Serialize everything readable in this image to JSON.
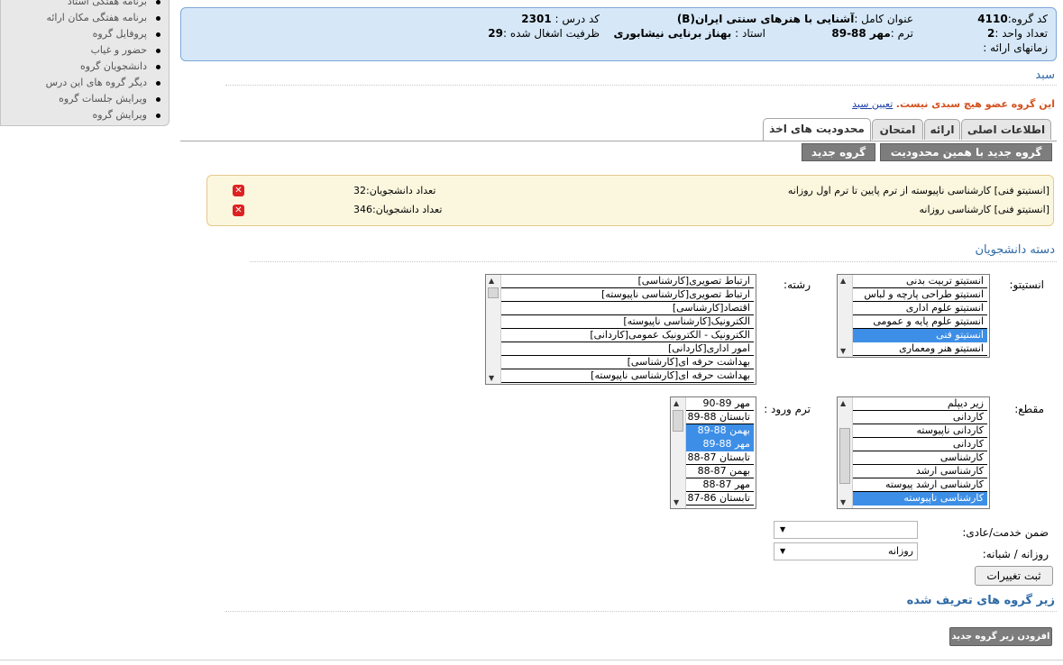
{
  "sidebar": {
    "items": [
      {
        "label": "برنامه هفتگی استاد"
      },
      {
        "label": "برنامه هفتگی مکان ارائه"
      },
      {
        "label": "پروفایل گروه"
      },
      {
        "label": "حضور و غیاب"
      },
      {
        "label": "دانشجویان گروه"
      },
      {
        "label": "دیگر گروه های این درس"
      },
      {
        "label": "ویرایش جلسات گروه"
      },
      {
        "label": "ویرایش گروه"
      }
    ]
  },
  "info": {
    "group_code_label": "کد گروه:",
    "group_code": "4110",
    "full_title_label": "عنوان کامل :",
    "full_title": "آشنایی با هنرهای سنتی ایران(B)",
    "course_code_label": "کد درس :",
    "course_code": "2301",
    "units_label": "تعداد واحد :",
    "units": "2",
    "term_label": "ترم :",
    "term": "مهر 88-89",
    "teacher_label": "استاد :",
    "teacher": "بهناز برنایی نیشابوری",
    "capacity_label": "ظرفیت اشغال شده :",
    "capacity": "29",
    "times_label": "زمانهای ارائه :"
  },
  "sabad": {
    "title": "سبد",
    "notice": "این گروه عضو هیچ سبدی نیست.",
    "link": "تعیین سبد"
  },
  "tabs": [
    {
      "label": "اطلاعات اصلی"
    },
    {
      "label": "ارائه"
    },
    {
      "label": "امتحان"
    },
    {
      "label": "محدودیت های اخذ"
    }
  ],
  "actions": {
    "new_same_label": "گروه جدید با همین محدودیت",
    "new_group_label": "گروه جدید"
  },
  "restrictions": [
    {
      "desc": "[انستیتو فنی] کارشناسی ناپیوسته از ترم پایین تا ترم اول روزانه",
      "count": "تعداد دانشجویان:32"
    },
    {
      "desc": "[انستیتو فنی] کارشناسی روزانه",
      "count": "تعداد دانشجویان:346"
    }
  ],
  "students_section": {
    "title": "دسته دانشجویان",
    "institute_label": "انستیتو:",
    "field_label": "رشته:",
    "level_label": "مقطع:",
    "entry_term_label": "ترم ورود :",
    "service_label": "ضمن خدمت/عادی:",
    "shift_label": "روزانه / شبانه:",
    "shift_value": "روزانه",
    "service_value": "",
    "save_label": "ثبت تغییرات"
  },
  "institutes": [
    {
      "label": "انستیتو تربیت بدنی",
      "selected": false
    },
    {
      "label": "انستیتو طراحی پارچه و لباس",
      "selected": false
    },
    {
      "label": "انستیتو علوم اداری",
      "selected": false
    },
    {
      "label": "انستیتو علوم پایه و عمومی",
      "selected": false
    },
    {
      "label": "انستیتو فنی",
      "selected": true
    },
    {
      "label": "انستیتو هنر ومعماری",
      "selected": false
    }
  ],
  "fields": [
    {
      "label": "ارتباط تصویری[کارشناسی]",
      "selected": false
    },
    {
      "label": "ارتباط تصویری[کارشناسی ناپیوسته]",
      "selected": false
    },
    {
      "label": "اقتصاد[کارشناسی]",
      "selected": false
    },
    {
      "label": "الکترونیک[کارشناسی ناپیوسته]",
      "selected": false
    },
    {
      "label": "الکترونیک - الکترونیک عمومی[کاردانی]",
      "selected": false
    },
    {
      "label": "امور اداری[کاردانی]",
      "selected": false
    },
    {
      "label": "بهداشت حرفه ای[کارشناسی]",
      "selected": false
    },
    {
      "label": "بهداشت حرفه ای[کارشناسی ناپیوسته]",
      "selected": false
    }
  ],
  "levels": [
    {
      "label": "زیر دیپلم",
      "selected": false
    },
    {
      "label": "کاردانی",
      "selected": false
    },
    {
      "label": "کاردانی ناپیوسته",
      "selected": false
    },
    {
      "label": "کاردانی",
      "selected": false
    },
    {
      "label": "کارشناسی",
      "selected": false
    },
    {
      "label": "کارشناسی ارشد",
      "selected": false
    },
    {
      "label": "کارشناسی ارشد پیوسته",
      "selected": false
    },
    {
      "label": "کارشناسی ناپیوسته",
      "selected": true
    }
  ],
  "entry_terms": [
    {
      "label": "مهر 89-90",
      "selected": false
    },
    {
      "label": "تابستان 88-89",
      "selected": false
    },
    {
      "label": "بهمن 88-89",
      "selected": true
    },
    {
      "label": "مهر 88-89",
      "selected": true
    },
    {
      "label": "تابستان 87-88",
      "selected": false
    },
    {
      "label": "بهمن 87-88",
      "selected": false
    },
    {
      "label": "مهر 87-88",
      "selected": false
    },
    {
      "label": "تابستان 86-87",
      "selected": false
    }
  ],
  "subgroups": {
    "title": "زیر گروه های تعریف شده",
    "add_label": "افزودن زیر گروه جدید"
  },
  "colors": {
    "accent": "#2f6aa6",
    "selection": "#3d8ee6",
    "notice": "#d3521f"
  }
}
